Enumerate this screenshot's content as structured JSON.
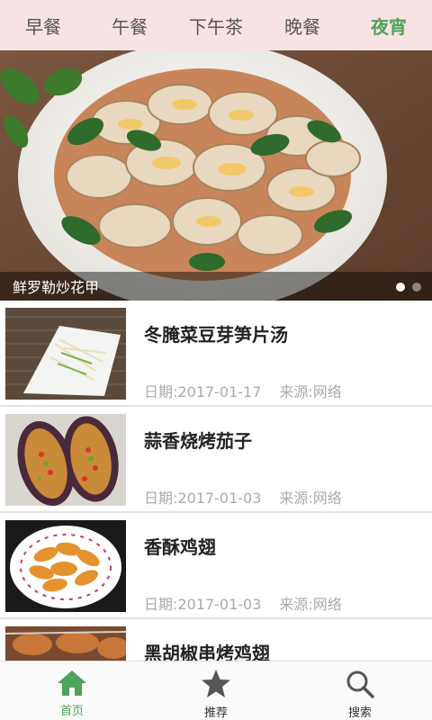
{
  "top_tabs": [
    {
      "label": "早餐"
    },
    {
      "label": "午餐"
    },
    {
      "label": "下午茶"
    },
    {
      "label": "晚餐"
    },
    {
      "label": "夜宵"
    }
  ],
  "active_tab": "夜宵",
  "banner": {
    "caption": "鲜罗勒炒花甲",
    "slide_count": 2,
    "current_slide": 1
  },
  "recipes": [
    {
      "title": "冬腌菜豆芽笋片汤",
      "date": "日期:2017-01-17",
      "source": "来源:网络"
    },
    {
      "title": "蒜香烧烤茄子",
      "date": "日期:2017-01-03",
      "source": "来源:网络"
    },
    {
      "title": "香酥鸡翅",
      "date": "日期:2017-01-03",
      "source": "来源:网络"
    },
    {
      "title": "黑胡椒串烤鸡翅",
      "date": "",
      "source": ""
    }
  ],
  "bottom_nav": [
    {
      "label": "首页",
      "icon": "home-icon"
    },
    {
      "label": "推荐",
      "icon": "star-icon"
    },
    {
      "label": "搜索",
      "icon": "search-icon"
    }
  ],
  "colors": {
    "accent": "#4fa35a",
    "topbar_bg": "#f7e3e3"
  }
}
